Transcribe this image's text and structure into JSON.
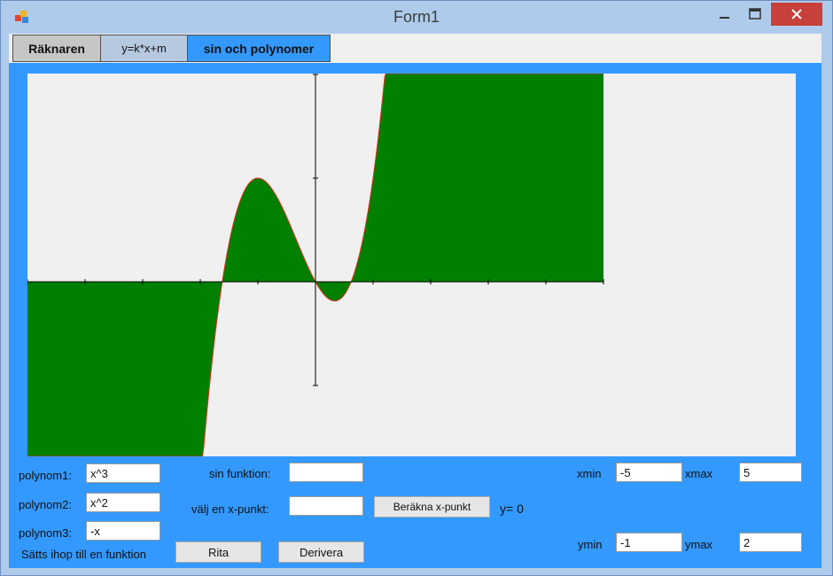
{
  "window": {
    "title": "Form1"
  },
  "tabs": [
    {
      "label": "Räknaren"
    },
    {
      "label": "y=k*x+m"
    },
    {
      "label": "sin och polynomer"
    }
  ],
  "plot": {
    "xmin": -5,
    "xmax": 5,
    "ymin": -1,
    "ymax": 2,
    "curve": "x^3 + x^2 - x",
    "fill_color": "#008000",
    "curve_color": "#e03020"
  },
  "form": {
    "polynom1": {
      "label": "polynom1:",
      "value": "x^3"
    },
    "polynom2": {
      "label": "polynom2:",
      "value": "x^2"
    },
    "polynom3": {
      "label": "polynom3:",
      "value": "-x"
    },
    "combine_note": "Sätts ihop till en funktion",
    "sin_label": "sin funktion:",
    "sin_value": "",
    "xpoint_label": "välj en x-punkt:",
    "xpoint_value": "",
    "calc_button": "Beräkna x-punkt",
    "result": "y= 0",
    "draw_button": "Rita",
    "derive_button": "Derivera",
    "xmin_label": "xmin",
    "xmin_value": "-5",
    "xmax_label": "xmax",
    "xmax_value": "5",
    "ymin_label": "ymin",
    "ymin_value": "-1",
    "ymax_label": "ymax",
    "ymax_value": "2"
  }
}
